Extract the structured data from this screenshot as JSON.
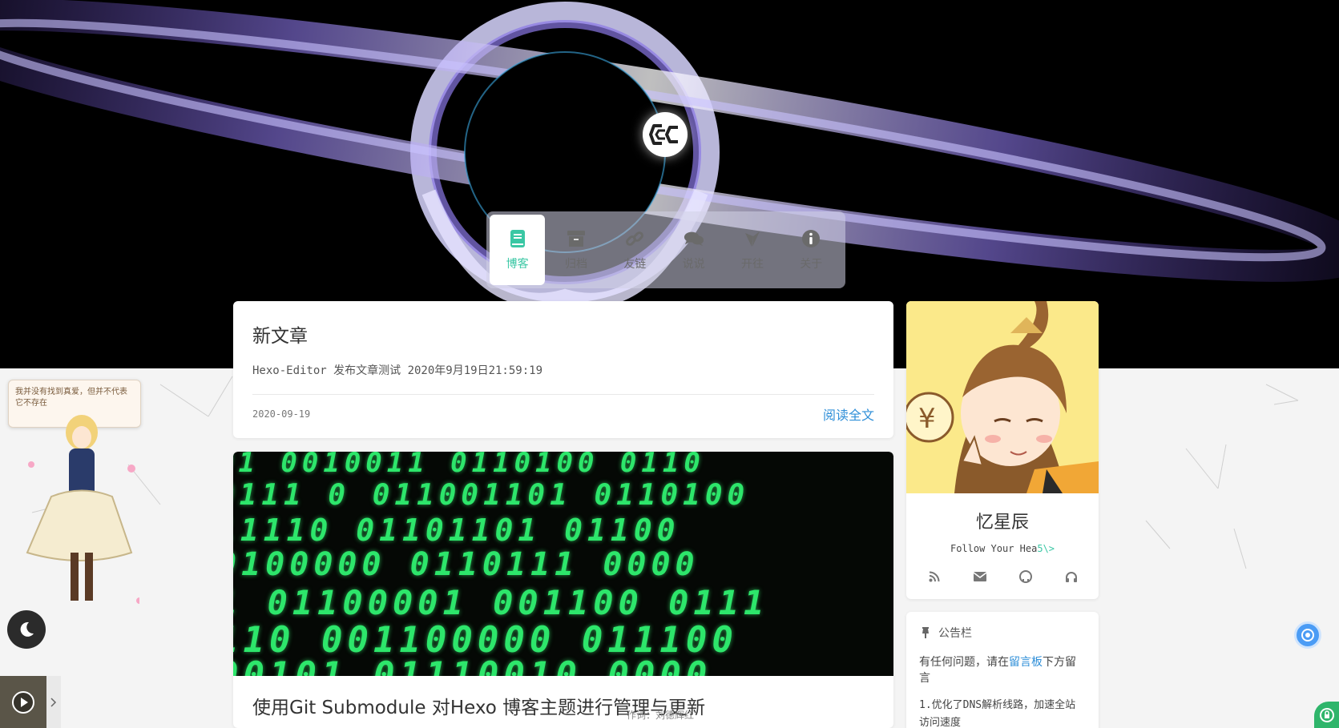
{
  "nav": {
    "items": [
      {
        "label": "博客",
        "icon": "book-icon",
        "active": true
      },
      {
        "label": "归档",
        "icon": "archive-icon",
        "active": false
      },
      {
        "label": "友链",
        "icon": "link-icon",
        "active": false
      },
      {
        "label": "说说",
        "icon": "comments-icon",
        "active": false
      },
      {
        "label": "开往",
        "icon": "travelling-icon",
        "active": false
      },
      {
        "label": "关于",
        "icon": "info-icon",
        "active": false
      }
    ]
  },
  "posts": [
    {
      "title": "新文章",
      "excerpt": "Hexo-Editor 发布文章测试 2020年9月19日21:59:19",
      "date": "2020-09-19",
      "read_more": "阅读全文"
    },
    {
      "title": "使用Git Submodule 对Hexo 博客主题进行管理与更新"
    }
  ],
  "profile": {
    "name": "忆星辰",
    "motto": "Follow Your Hea",
    "motto_cursor": "5\\>",
    "links": [
      "rss-icon",
      "envelope-icon",
      "github-icon",
      "headphones-icon"
    ]
  },
  "notice": {
    "title": "公告栏",
    "text_before": "有任何问题，请在",
    "text_link": "留言板",
    "text_after": "下方留言",
    "items": [
      "1.优化了DNS解析线路，加速全站访问速度"
    ]
  },
  "widgets": {
    "speech": "我并没有找到真爱，但并不代表它不存在",
    "lyric": "作词：刘德辉红"
  },
  "colors": {
    "accent": "#3ac7a4",
    "link": "#2f8fd8",
    "binary": "#2de66b"
  }
}
